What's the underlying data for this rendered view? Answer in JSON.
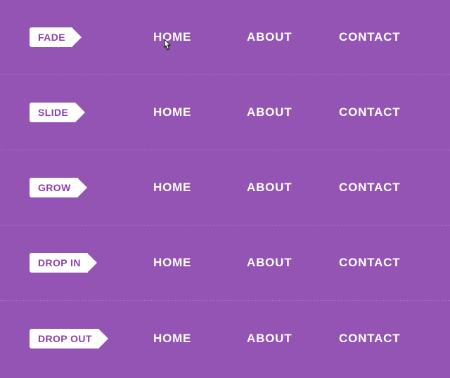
{
  "colors": {
    "bg": "#9354b3",
    "tag_bg": "#ffffff",
    "tag_fg": "#8a3fab",
    "link": "#ffffff"
  },
  "nav": [
    "HOME",
    "ABOUT",
    "CONTACT"
  ],
  "rows": [
    {
      "tag": "FADE"
    },
    {
      "tag": "SLIDE"
    },
    {
      "tag": "GROW"
    },
    {
      "tag": "DROP IN"
    },
    {
      "tag": "DROP OUT"
    }
  ]
}
